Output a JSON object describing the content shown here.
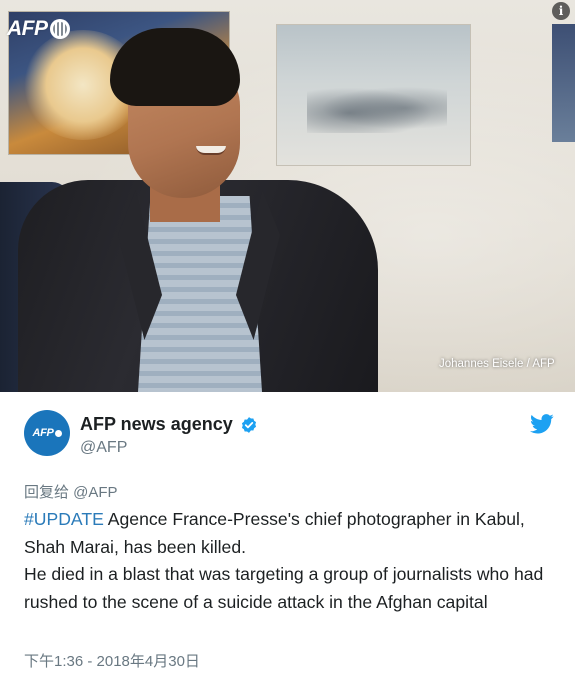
{
  "photo": {
    "source_logo": "AFP",
    "credit": "Johannes Eisele / AFP",
    "info_icon": "i"
  },
  "tweet": {
    "avatar_label": "AFP",
    "display_name": "AFP news agency",
    "handle": "@AFP",
    "reply_to": "回复给 @AFP",
    "hashtag": "#UPDATE",
    "line1_rest": " Agence France-Presse's chief photographer in Kabul, Shah Marai, has been killed.",
    "line2": "He died in a blast that was targeting a group of journalists who had rushed to the scene of a suicide attack in the Afghan capital",
    "timestamp": "下午1:36 - 2018年4月30日"
  },
  "colors": {
    "brand_blue": "#1a75bb",
    "hashtag_blue": "#2b7bb9",
    "twitter_blue": "#1da1f2",
    "secondary_text": "#697882"
  },
  "icons": {
    "verified": "verified-badge-icon",
    "twitter": "twitter-bird-icon",
    "info": "info-icon"
  }
}
